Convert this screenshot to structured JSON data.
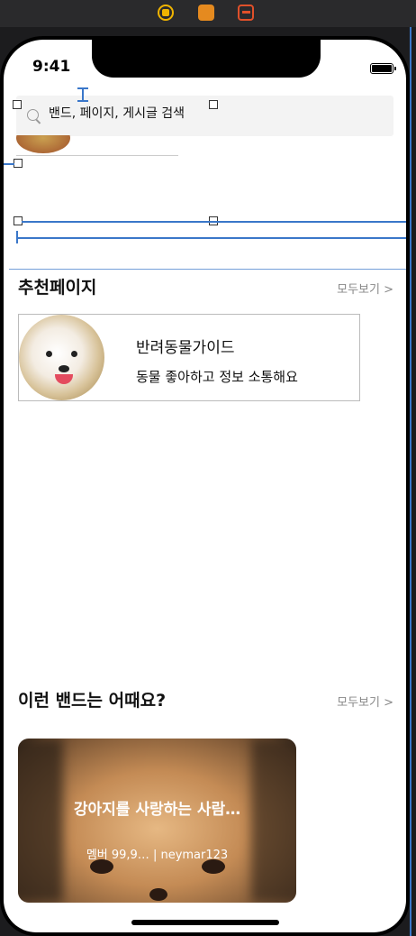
{
  "status_bar": {
    "time": "9:41"
  },
  "search": {
    "placeholder": "밴드, 페이지, 게시글 검색"
  },
  "recommended_pages": {
    "title": "추천페이지",
    "see_all": "모두보기 >",
    "items": [
      {
        "name": "반려동물가이드",
        "description": "동물 좋아하고 정보 소통해요"
      }
    ]
  },
  "band_suggestions": {
    "title": "이런 밴드는 어때요?",
    "see_all": "모두보기 >",
    "items": [
      {
        "name": "강아지를 사랑하는 사람…",
        "meta": "멤버 99,9… | neymar123"
      }
    ]
  },
  "icons": [
    "view-controller-icon",
    "first-responder-icon",
    "exit-icon",
    "search-icon",
    "battery-icon"
  ],
  "colors": {
    "selection_blue": "#3a77c9",
    "search_bg": "#f3f3f3",
    "see_all": "#888888"
  }
}
